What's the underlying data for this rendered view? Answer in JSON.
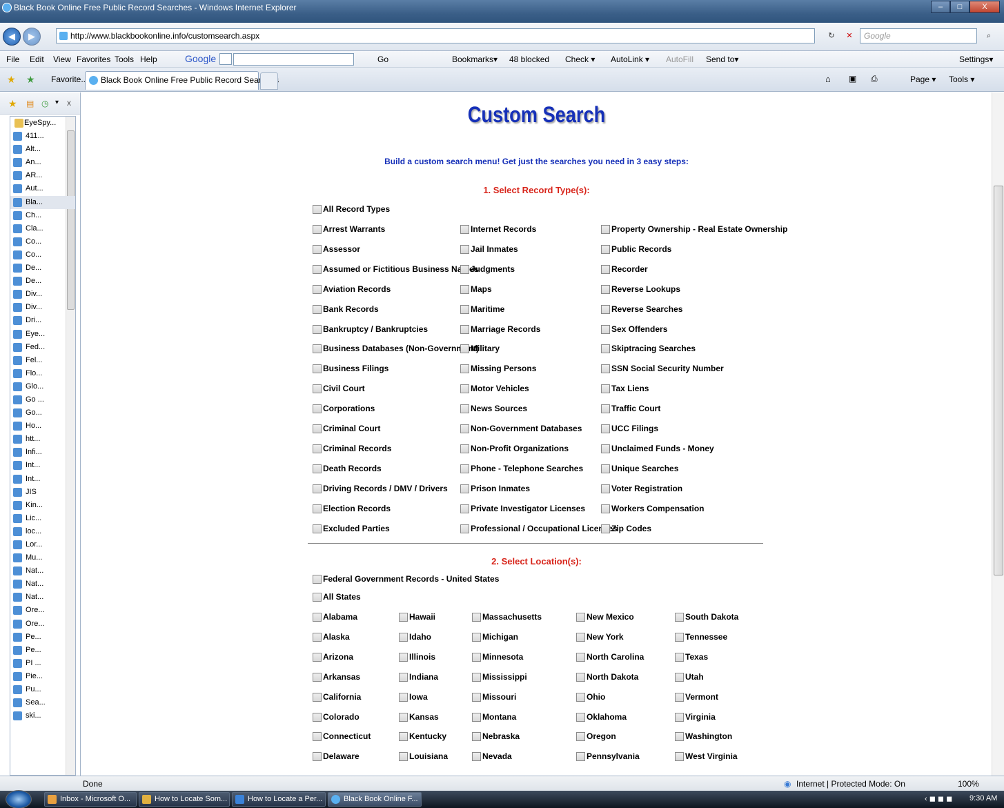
{
  "window": {
    "title": "Black Book Online Free Public Record Searches - Windows Internet Explorer",
    "buttons": [
      "–",
      "□",
      "X"
    ]
  },
  "address_bar": {
    "url": "http://www.blackbookonline.info/customsearch.aspx",
    "search_placeholder": "Google"
  },
  "menu": {
    "items": [
      "File",
      "Edit",
      "View",
      "Favorites",
      "Tools",
      "Help"
    ],
    "google_label": "Google",
    "toolbar_items": [
      "Go",
      "Bookmarks▾",
      "48 blocked",
      "Check ▾",
      "AutoLink ▾",
      "AutoFill",
      "Send to▾"
    ],
    "settings": "Settings▾"
  },
  "tabs": {
    "favorites_label": "Favorite...",
    "active_tab": "Black Book Online Free Public Record Searches",
    "tools": [
      "Page ▾",
      "Tools ▾"
    ]
  },
  "sidebar": {
    "items": [
      "EyeSpy...",
      "411...",
      "Alt...",
      "An...",
      "AR...",
      "Aut...",
      "Bla...",
      "Ch...",
      "Cla...",
      "Co...",
      "Co...",
      "De...",
      "De...",
      "Div...",
      "Div...",
      "Dri...",
      "Eye...",
      "Fed...",
      "Fel...",
      "Flo...",
      "Glo...",
      "Go ...",
      "Go...",
      "Ho...",
      "htt...",
      "Infi...",
      "Int...",
      "Int...",
      "JIS",
      "Kin...",
      "Lic...",
      "loc...",
      "Lor...",
      "Mu...",
      "Nat...",
      "Nat...",
      "Nat...",
      "Ore...",
      "Ore...",
      "Pe...",
      "Pe...",
      "PI ...",
      "Pie...",
      "Pu...",
      "Sea...",
      "ski..."
    ]
  },
  "page": {
    "heading": "Custom Search",
    "intro": "Build a custom search menu! Get just the searches you need in 3 easy steps:",
    "step1": "1. Select Record Type(s):",
    "all_record_types": "All Record Types",
    "record_col1": [
      "Arrest Warrants",
      "Assessor",
      "Assumed or Fictitious Business Names",
      "Aviation Records",
      "Bank Records",
      "Bankruptcy / Bankruptcies",
      "Business Databases (Non-Government)",
      "Business Filings",
      "Civil Court",
      "Corporations",
      "Criminal Court",
      "Criminal Records",
      "Death Records",
      "Driving Records / DMV / Drivers",
      "Election Records",
      "Excluded Parties"
    ],
    "record_col2": [
      "Internet Records",
      "Jail Inmates",
      "Judgments",
      "Maps",
      "Maritime",
      "Marriage Records",
      "Military",
      "Missing Persons",
      "Motor Vehicles",
      "News Sources",
      "Non-Government Databases",
      "Non-Profit Organizations",
      "Phone - Telephone Searches",
      "Prison Inmates",
      "Private Investigator Licenses",
      "Professional / Occupational Licenses"
    ],
    "record_col3": [
      "Property Ownership - Real Estate Ownership",
      "Public Records",
      "Recorder",
      "Reverse Lookups",
      "Reverse Searches",
      "Sex Offenders",
      "Skiptracing Searches",
      "SSN Social Security Number",
      "Tax Liens",
      "Traffic Court",
      "UCC Filings",
      "Unclaimed Funds - Money",
      "Unique Searches",
      "Voter Registration",
      "Workers Compensation",
      "Zip Codes"
    ],
    "step2": "2. Select Location(s):",
    "federal": "Federal Government Records - United States",
    "all_states": "All States",
    "states_col1": [
      "Alabama",
      "Alaska",
      "Arizona",
      "Arkansas",
      "California",
      "Colorado",
      "Connecticut",
      "Delaware"
    ],
    "states_col2": [
      "Hawaii",
      "Idaho",
      "Illinois",
      "Indiana",
      "Iowa",
      "Kansas",
      "Kentucky",
      "Louisiana"
    ],
    "states_col3": [
      "Massachusetts",
      "Michigan",
      "Minnesota",
      "Mississippi",
      "Missouri",
      "Montana",
      "Nebraska",
      "Nevada"
    ],
    "states_col4": [
      "New Mexico",
      "New York",
      "North Carolina",
      "North Dakota",
      "Ohio",
      "Oklahoma",
      "Oregon",
      "Pennsylvania"
    ],
    "states_col5": [
      "South Dakota",
      "Tennessee",
      "Texas",
      "Utah",
      "Vermont",
      "Virginia",
      "Washington",
      "West Virginia"
    ]
  },
  "status": {
    "text": "Done",
    "zone": "Internet | Protected Mode: On",
    "zoom": "100%"
  },
  "taskbar": {
    "tasks": [
      "Inbox - Microsoft O...",
      "How to Locate Som...",
      "How to Locate a Per...",
      "Black Book Online F..."
    ],
    "clock": "9:30 AM"
  },
  "colors": {
    "heading": "#1630b8",
    "step": "#d8251b"
  }
}
